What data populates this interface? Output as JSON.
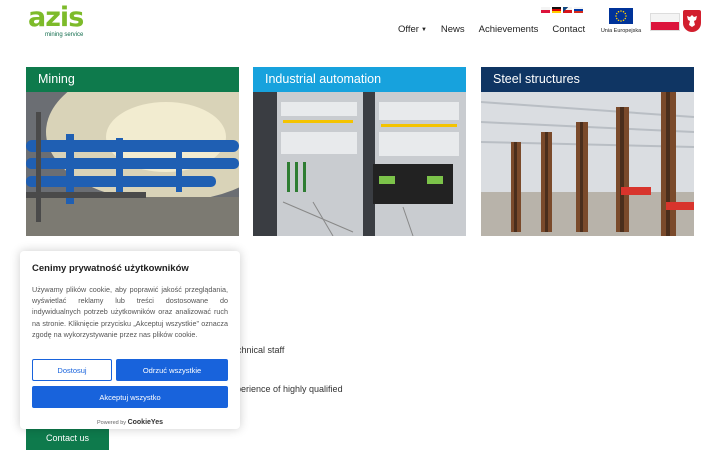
{
  "header": {
    "logo_text": "azis",
    "logo_subtitle": "mining service",
    "nav": [
      {
        "label": "Offer",
        "has_dropdown": true
      },
      {
        "label": "News"
      },
      {
        "label": "Achievements"
      },
      {
        "label": "Contact"
      }
    ],
    "eu_label": "Unia Europejska",
    "language_flags": [
      "pl-flag",
      "de-flag",
      "cz-flag",
      "ru-flag"
    ]
  },
  "cards": [
    {
      "title": "Mining",
      "color": "#0e7a4c"
    },
    {
      "title": "Industrial automation",
      "color": "#17a2dd"
    },
    {
      "title": "Steel structures",
      "color": "#0f3563"
    }
  ],
  "body": {
    "fragment1": "chnical staff",
    "fragment2": "perience of highly qualified",
    "contact_button": "Contact us"
  },
  "cookie": {
    "title": "Cenimy prywatność użytkowników",
    "description": "Używamy plików cookie, aby poprawić jakość przeglądania, wyświetlać reklamy lub treści dostosowane do indywidualnych potrzeb użytkowników oraz analizować ruch na stronie. Kliknięcie przycisku „Akceptuj wszystkie” oznacza zgodę na wykorzystywanie przez nas plików cookie.",
    "customize_label": "Dostosuj",
    "reject_label": "Odrzuć wszystkie",
    "accept_label": "Akceptuj wszystko",
    "powered_by": "Powered by",
    "brand": "CookieYes"
  }
}
